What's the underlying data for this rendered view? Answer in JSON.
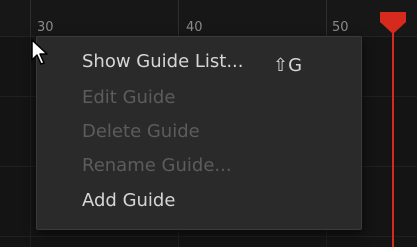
{
  "ruler": {
    "ticks": [
      "30",
      "40",
      "50"
    ]
  },
  "context_menu": {
    "items": [
      {
        "label": "Show Guide List...",
        "shortcut": "⇧G",
        "enabled": true
      },
      {
        "label": "Edit Guide",
        "enabled": false
      },
      {
        "label": "Delete Guide",
        "enabled": false
      },
      {
        "label": "Rename Guide...",
        "enabled": false
      },
      {
        "label": "Add Guide",
        "enabled": true
      }
    ]
  },
  "playhead": {
    "color": "#d62a1e"
  },
  "icons": {
    "playhead": "playhead-marker-icon",
    "cursor": "mouse-pointer-icon"
  }
}
